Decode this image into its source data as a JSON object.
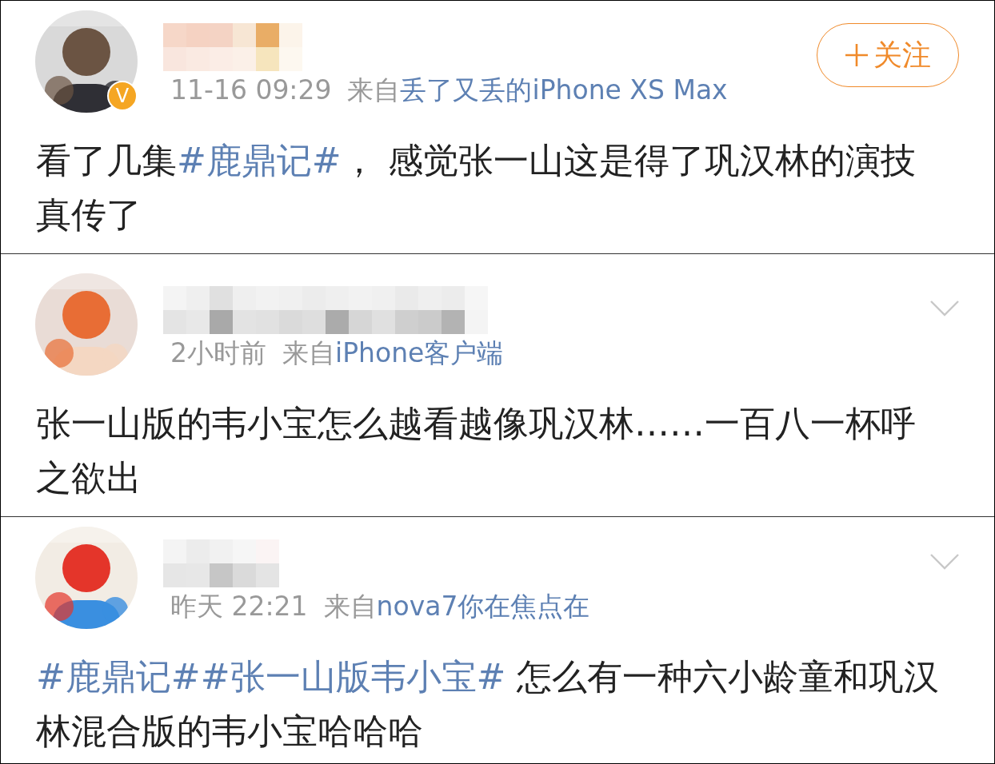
{
  "posts": [
    {
      "verified": true,
      "verified_badge": "V",
      "time": "11-16 09:29",
      "from_label": "来自",
      "source": "丢了又丢的iPhone XS Max",
      "follow_label": "关注",
      "body": [
        {
          "kind": "text",
          "text": "看了几集"
        },
        {
          "kind": "topic",
          "text": "#鹿鼎记#"
        },
        {
          "kind": "text",
          "text": "， 感觉张一山这是得了巩汉林的演技真传了"
        }
      ]
    },
    {
      "verified": false,
      "time": "2小时前",
      "from_label": "来自",
      "source": "iPhone客户端",
      "body": [
        {
          "kind": "text",
          "text": "张一山版的韦小宝怎么越看越像巩汉林……一百八一杯呼之欲出"
        }
      ]
    },
    {
      "verified": false,
      "time": "昨天 22:21",
      "from_label": "来自",
      "source": "nova7你在焦点在",
      "body": [
        {
          "kind": "topic",
          "text": "#鹿鼎记##张一山版韦小宝#"
        },
        {
          "kind": "text",
          "text": " 怎么有一种六小龄童和巩汉林混合版的韦小宝哈哈哈"
        }
      ]
    }
  ]
}
